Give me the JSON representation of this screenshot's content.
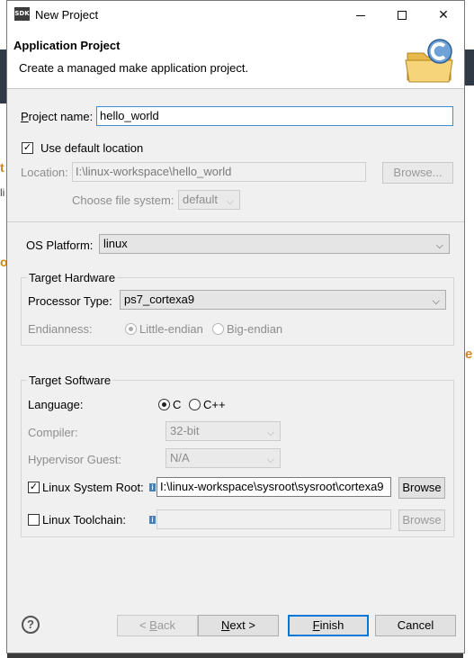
{
  "window": {
    "title": "New Project",
    "icon_text": "SDK"
  },
  "banner": {
    "title": "Application Project",
    "description": "Create a managed make application project."
  },
  "project": {
    "name_label": "Project name:",
    "name_value": "hello_world",
    "use_default_label": "Use default location",
    "use_default_checked": true,
    "location_label": "Location:",
    "location_value": "I:\\linux-workspace\\hello_world",
    "browse_label": "Browse...",
    "filesystem_label": "Choose file system:",
    "filesystem_value": "default"
  },
  "os": {
    "label": "OS Platform:",
    "value": "linux"
  },
  "hardware": {
    "title": "Target Hardware",
    "processor_label": "Processor Type:",
    "processor_value": "ps7_cortexa9",
    "endianness_label": "Endianness:",
    "little_label": "Little-endian",
    "big_label": "Big-endian"
  },
  "software": {
    "title": "Target Software",
    "language_label": "Language:",
    "lang_c": "C",
    "lang_cpp": "C++",
    "compiler_label": "Compiler:",
    "compiler_value": "32-bit",
    "hypervisor_label": "Hypervisor Guest:",
    "hypervisor_value": "N/A",
    "sysroot_label": "Linux System Root:",
    "sysroot_checked": true,
    "sysroot_value": "I:\\linux-workspace\\sysroot\\sysroot\\cortexa9",
    "sysroot_browse": "Browse",
    "toolchain_label": "Linux Toolchain:",
    "toolchain_checked": false,
    "toolchain_value": "",
    "toolchain_browse": "Browse"
  },
  "footer": {
    "help": "?",
    "back": "< Back",
    "next": "Next >",
    "finish": "Finish",
    "cancel": "Cancel"
  },
  "background": {
    "right_text": "e",
    "left_1": "t",
    "left_2": "li",
    "left_3": "o"
  },
  "colors": {
    "focus": "#3a8fd6",
    "default_button": "#0078d7",
    "disabled_text": "#8d8d8d"
  }
}
